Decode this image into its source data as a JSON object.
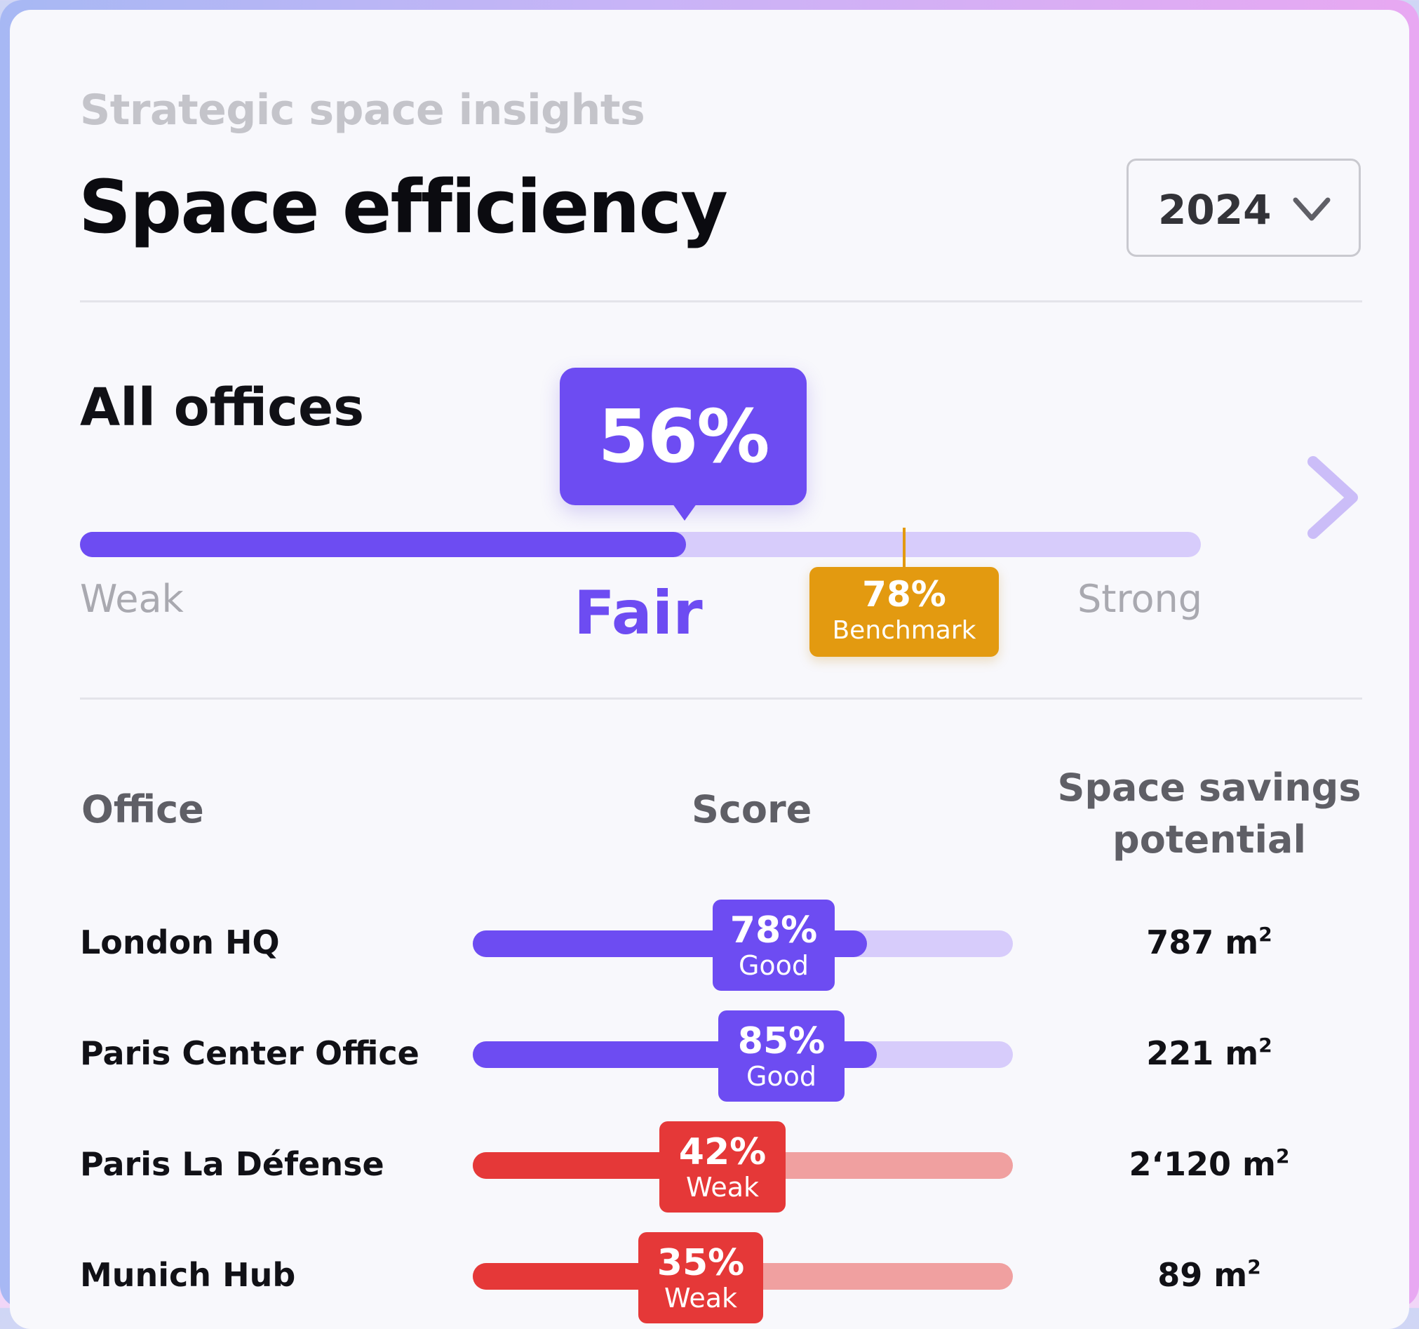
{
  "header": {
    "eyebrow": "Strategic space insights",
    "title": "Space efficiency",
    "year": "2024"
  },
  "summary": {
    "label": "All offices",
    "score": "56%",
    "score_value": 56,
    "rating": "Fair",
    "scale_low": "Weak",
    "scale_high": "Strong",
    "benchmark_value": "78%",
    "benchmark_label": "Benchmark",
    "benchmark_level": 78
  },
  "table": {
    "headers": {
      "office": "Office",
      "score": "Score",
      "savings": "Space savings potential"
    },
    "rows": [
      {
        "office": "London HQ",
        "score": "78%",
        "score_value": 78,
        "rating": "Good",
        "savings_value": "787 m",
        "savings_unit_sup": "2",
        "status": "good"
      },
      {
        "office": "Paris Center Office",
        "score": "85%",
        "score_value": 85,
        "rating": "Good",
        "savings_value": "221 m",
        "savings_unit_sup": "2",
        "status": "good"
      },
      {
        "office": "Paris La Défense",
        "score": "42%",
        "score_value": 42,
        "rating": "Weak",
        "savings_value": "2‘120 m",
        "savings_unit_sup": "2",
        "status": "weak"
      },
      {
        "office": "Munich Hub",
        "score": "35%",
        "score_value": 35,
        "rating": "Weak",
        "savings_value": "89 m",
        "savings_unit_sup": "2",
        "status": "weak"
      }
    ]
  },
  "colors": {
    "accent": "#6d4cf2",
    "accent_light": "#d7ccfb",
    "benchmark": "#e39a10",
    "weak": "#e53838",
    "weak_light": "#f0a0a0"
  },
  "icons": {
    "year_dropdown": "chevron-down-icon",
    "next": "chevron-right-icon"
  }
}
